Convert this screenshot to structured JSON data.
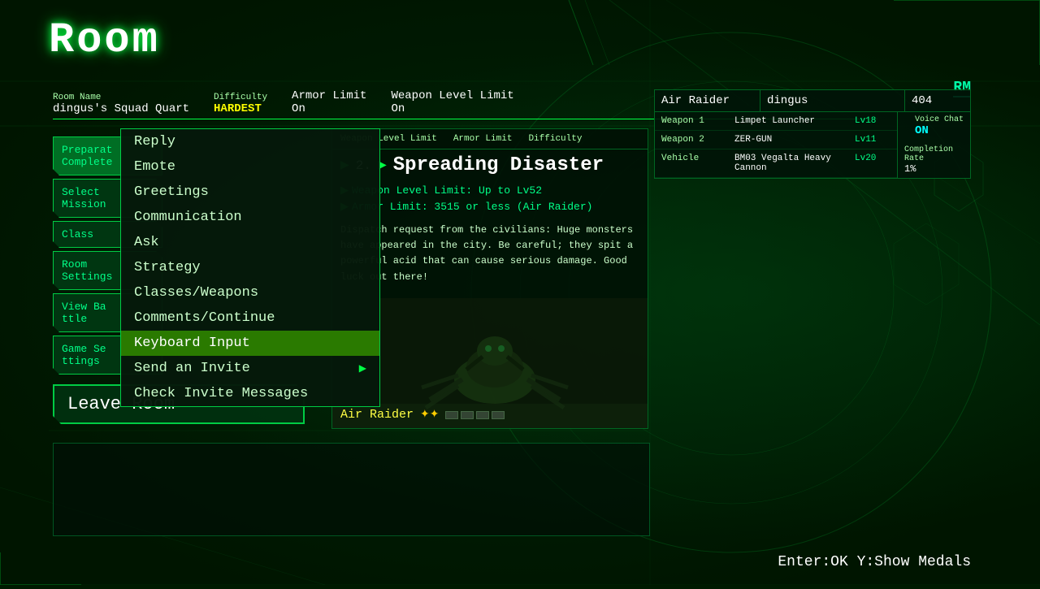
{
  "page": {
    "title": "Room",
    "rm_badge": "RM"
  },
  "room_info": {
    "room_name_label": "Room Name",
    "room_name": "dingus's Squad Quart",
    "difficulty_label": "Difficulty",
    "difficulty": "HARDEST",
    "armor_limit_label": "Armor Limit",
    "armor_limit": "On",
    "weapon_level_label": "Weapon Level Limit",
    "weapon_level": "On"
  },
  "sidebar_buttons": [
    {
      "id": "preparation",
      "label": "Preparat"
    },
    {
      "id": "select",
      "label": "Select"
    },
    {
      "id": "class",
      "label": "Class"
    },
    {
      "id": "room",
      "label": "Room"
    },
    {
      "id": "view-battle",
      "label": "View Ba"
    },
    {
      "id": "game",
      "label": "Game S"
    }
  ],
  "leave_room": "Leave Room",
  "context_menu": {
    "items": [
      {
        "id": "reply",
        "label": "Reply",
        "has_arrow": false
      },
      {
        "id": "emote",
        "label": "Emote",
        "has_arrow": false
      },
      {
        "id": "greetings",
        "label": "Greetings",
        "has_arrow": false
      },
      {
        "id": "communication",
        "label": "Communication",
        "has_arrow": false
      },
      {
        "id": "ask",
        "label": "Ask",
        "has_arrow": false
      },
      {
        "id": "strategy",
        "label": "Strategy",
        "has_arrow": false
      },
      {
        "id": "classes-weapons",
        "label": "Classes/Weapons",
        "has_arrow": false
      },
      {
        "id": "comments-continue",
        "label": "Comments/Continue",
        "has_arrow": false
      },
      {
        "id": "keyboard-input",
        "label": "Keyboard Input",
        "has_arrow": false,
        "selected": true
      },
      {
        "id": "send-invite",
        "label": "Send an Invite",
        "has_arrow": true
      },
      {
        "id": "check-invite",
        "label": "Check Invite Messages",
        "has_arrow": false
      }
    ]
  },
  "mission": {
    "number": "2.",
    "name": "Spreading Disaster",
    "weapon_level_line": "Weapon Level Limit:  Up to Lv52",
    "armor_limit_line": "Armor Limit:  3515 or less (Air Raider)",
    "description": "Dispatch request from the civilians: Huge monsters have appeared in the city. Be careful; they spit a powerful acid that can cause serious damage. Good luck out there!",
    "class_name": "Air Raider",
    "stars": "✦✦",
    "health_segs": [
      0,
      0,
      0,
      0
    ]
  },
  "player_panel": {
    "class": "Air Raider",
    "username": "dingus",
    "score": "404",
    "weapons": [
      {
        "slot": "Weapon 1",
        "name": "Limpet Launcher",
        "level": "Lv18"
      },
      {
        "slot": "Weapon 2",
        "name": "ZER-GUN",
        "level": "Lv11"
      },
      {
        "slot": "Vehicle",
        "name": "BM03 Vegalta Heavy Cannon",
        "level": "Lv20"
      }
    ],
    "voice_chat_label": "Voice Chat",
    "voice_chat": "ON",
    "completion_label": "Completion Rate",
    "completion": "1%"
  },
  "bottom": {
    "hint": "Enter:OK  Y:Show Medals"
  }
}
